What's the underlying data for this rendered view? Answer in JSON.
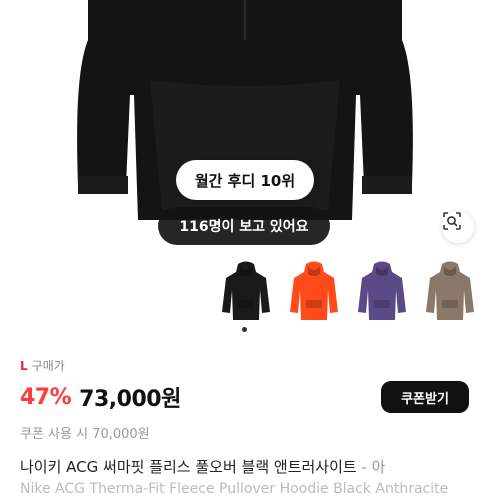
{
  "product_image": {
    "alt_name": "black-hoodie"
  },
  "badges": {
    "rank": "월간 후디 10위",
    "viewers": "116명이 보고 있어요"
  },
  "color_options": [
    {
      "name": "black",
      "color": "#1a1a1a"
    },
    {
      "name": "orange",
      "color": "#ff4a1c"
    },
    {
      "name": "purple",
      "color": "#5b4a86"
    },
    {
      "name": "taupe",
      "color": "#8a7868"
    }
  ],
  "price": {
    "size_prefix": "L",
    "size_label": "구매가",
    "discount": "47%",
    "amount": "73,000원",
    "coupon_button": "쿠폰받기",
    "coupon_price": "쿠폰 사용 시 70,000원"
  },
  "product": {
    "title": "나이키 ACG 써마핏 플리스 풀오버 블랙 앤트러사이트",
    "title_separator": " - ",
    "title_suffix": "아",
    "subtitle": "Nike ACG Therma-Fit Fleece Pullover Hoodie Black Anthracite"
  }
}
